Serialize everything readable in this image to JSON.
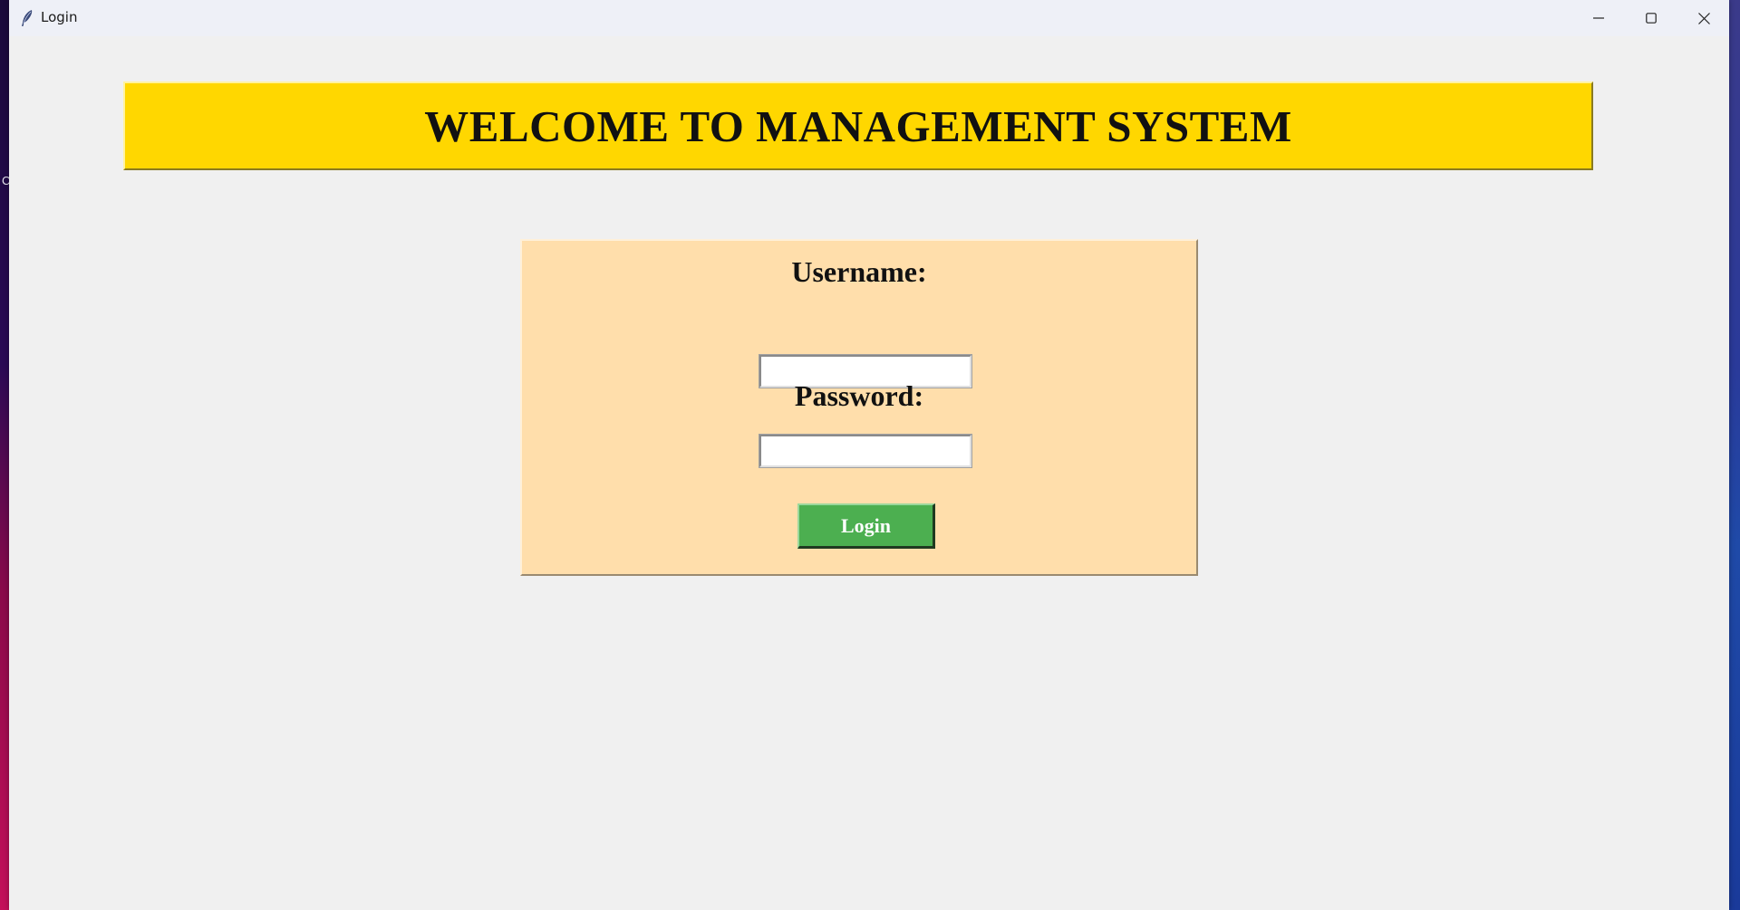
{
  "window": {
    "title": "Login",
    "controls": {
      "minimize_icon": "minimize-icon",
      "maximize_icon": "maximize-icon",
      "close_icon": "close-icon"
    }
  },
  "banner": {
    "title": "WELCOME TO MANAGEMENT SYSTEM",
    "background_color": "#ffd700"
  },
  "login_form": {
    "background_color": "#ffdeab",
    "username_label": "Username:",
    "username_value": "",
    "password_label": "Password:",
    "password_value": "",
    "login_button_label": "Login",
    "login_button_color": "#4caf50"
  },
  "desktop": {
    "edge_glyph": "C"
  }
}
